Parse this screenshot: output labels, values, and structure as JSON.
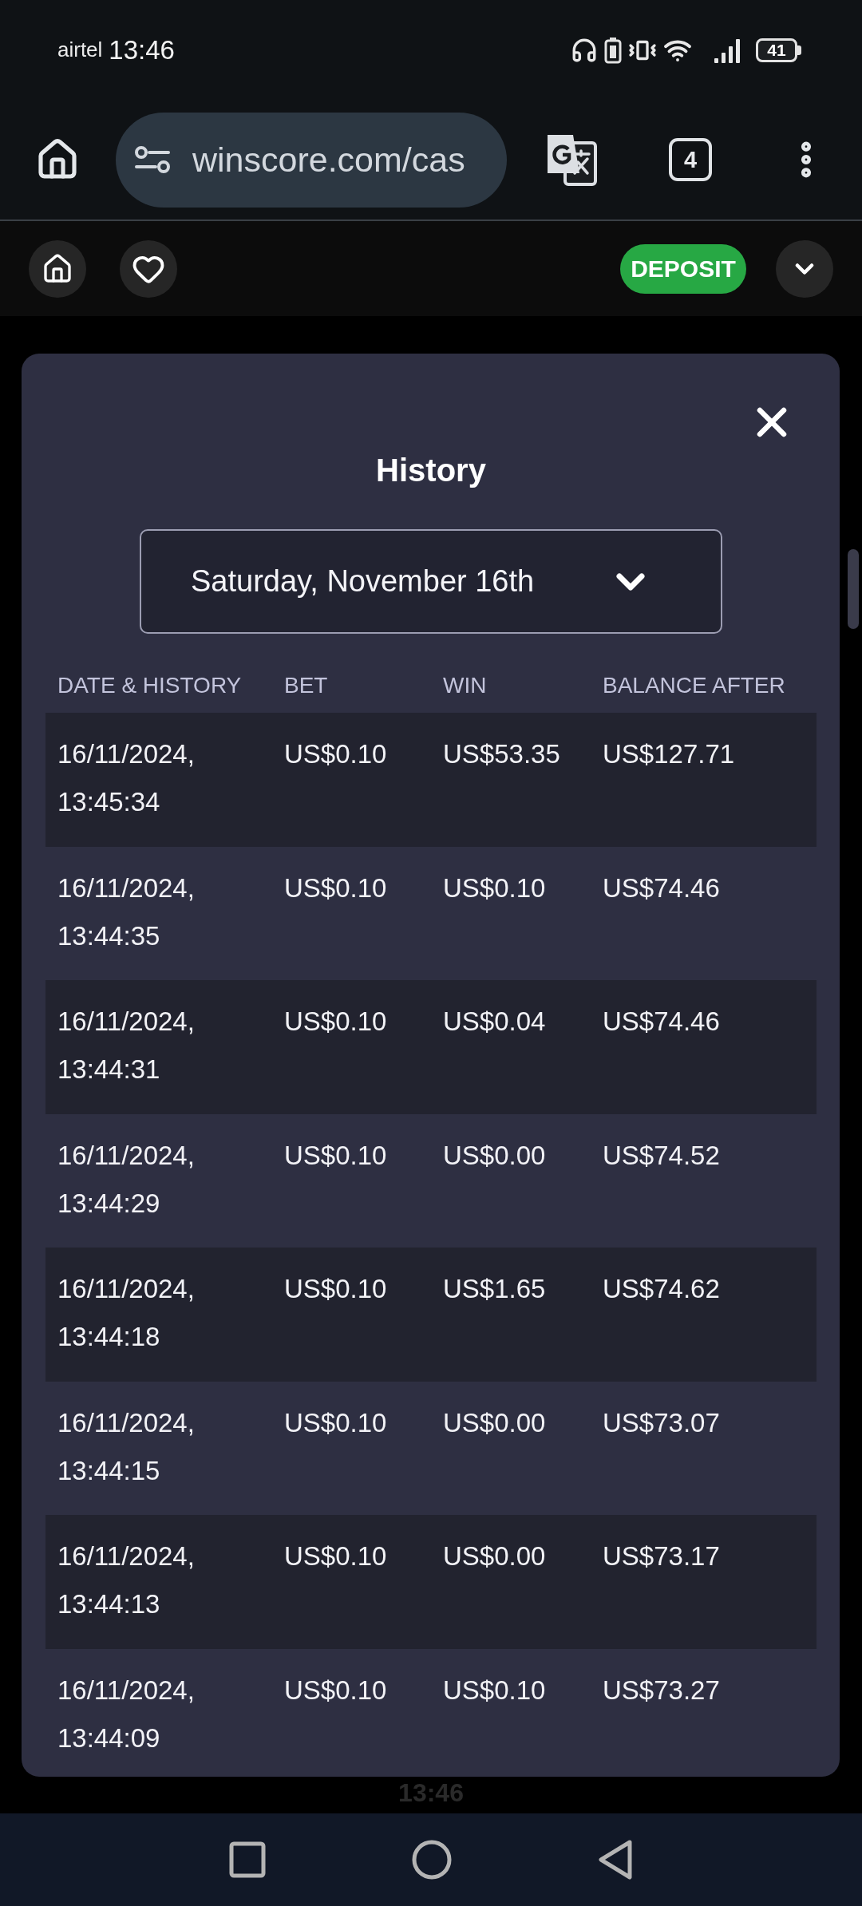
{
  "status_bar": {
    "carrier": "airtel",
    "time": "13:46",
    "battery": "41"
  },
  "browser_bar": {
    "url": "winscore.com/cas",
    "tab_count": "4"
  },
  "site_header": {
    "deposit_button": "DEPOSIT"
  },
  "history_modal": {
    "title": "History",
    "date_select": {
      "value": "Saturday, November 16th"
    },
    "table": {
      "columns": [
        "DATE & HISTORY",
        "BET",
        "WIN",
        "BALANCE AFTER"
      ],
      "rows": [
        {
          "date_time": "16/11/2024, 13:45:34",
          "bet": "US$0.10",
          "win": "US$53.35",
          "balance_after": "US$127.71"
        },
        {
          "date_time": "16/11/2024, 13:44:35",
          "bet": "US$0.10",
          "win": "US$0.10",
          "balance_after": "US$74.46"
        },
        {
          "date_time": "16/11/2024, 13:44:31",
          "bet": "US$0.10",
          "win": "US$0.04",
          "balance_after": "US$74.46"
        },
        {
          "date_time": "16/11/2024, 13:44:29",
          "bet": "US$0.10",
          "win": "US$0.00",
          "balance_after": "US$74.52"
        },
        {
          "date_time": "16/11/2024, 13:44:18",
          "bet": "US$0.10",
          "win": "US$1.65",
          "balance_after": "US$74.62"
        },
        {
          "date_time": "16/11/2024, 13:44:15",
          "bet": "US$0.10",
          "win": "US$0.00",
          "balance_after": "US$73.07"
        },
        {
          "date_time": "16/11/2024, 13:44:13",
          "bet": "US$0.10",
          "win": "US$0.00",
          "balance_after": "US$73.17"
        },
        {
          "date_time": "16/11/2024, 13:44:09",
          "bet": "US$0.10",
          "win": "US$0.10",
          "balance_after": "US$73.27"
        }
      ]
    }
  },
  "background_clock": "13:46"
}
